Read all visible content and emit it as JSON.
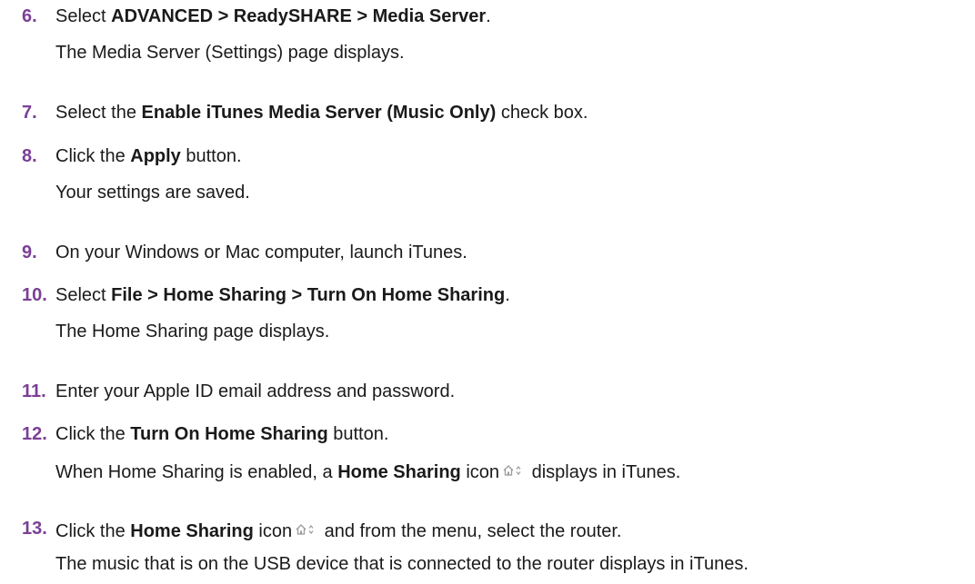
{
  "steps": [
    {
      "num": "6.",
      "pre": "Select ",
      "bold": "ADVANCED > ReadySHARE > Media Server",
      "post": ".",
      "result": "The Media Server (Settings) page displays."
    },
    {
      "num": "7.",
      "pre": "Select the ",
      "bold": "Enable iTunes Media Server (Music Only)",
      "post": " check box."
    },
    {
      "num": "8.",
      "pre": "Click the ",
      "bold": "Apply",
      "post": " button.",
      "result": "Your settings are saved."
    },
    {
      "num": "9.",
      "text": "On your Windows or Mac computer, launch iTunes."
    },
    {
      "num": "10.",
      "pre": "Select ",
      "bold": "File > Home Sharing > Turn On Home Sharing",
      "post": ".",
      "result": "The Home Sharing page displays."
    },
    {
      "num": "11.",
      "text": "Enter your Apple ID email address and password."
    },
    {
      "num": "12.",
      "pre": "Click the ",
      "bold": "Turn On Home Sharing",
      "post": " button.",
      "result_pre": "When Home Sharing is enabled, a ",
      "result_bold": "Home Sharing",
      "result_mid": " icon",
      "result_post": " displays in iTunes."
    },
    {
      "num": "13.",
      "pre": "Click the ",
      "bold": "Home Sharing",
      "mid": " icon",
      "post": " and from the menu, select the router.",
      "result": "The music that is on the USB device that is connected to the router displays in iTunes."
    }
  ],
  "icons": {
    "home_sharing": "home-sharing-icon"
  },
  "colors": {
    "step_number": "#7b3f95",
    "text": "#1a1a1a"
  }
}
